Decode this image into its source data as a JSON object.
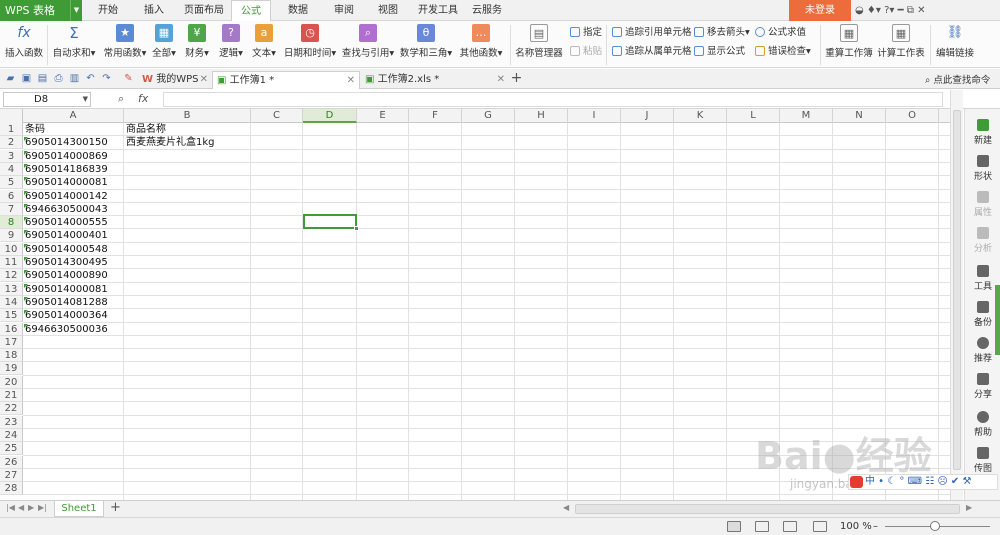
{
  "app": {
    "logo": "WPS 表格",
    "login": "未登录",
    "top_icons": "◒ ♦▾ ?▾  ━ ⧉ ✕"
  },
  "menu": [
    "开始",
    "插入",
    "页面布局",
    "公式",
    "数据",
    "审阅",
    "视图",
    "开发工具",
    "云服务"
  ],
  "menu_active": "公式",
  "ribbon": {
    "insert_function": "插入函数",
    "autosum": "自动求和",
    "common": "常用函数",
    "all": "全部",
    "finance": "财务",
    "logic": "逻辑",
    "text": "文本",
    "datetime": "日期和时间",
    "lookup": "查找与引用",
    "math": "数学和三角",
    "other": "其他函数",
    "name_manager": "名称管理器",
    "specify": "指定",
    "paste": "粘贴",
    "trace_precedents": "追踪引用单元格",
    "trace_dependents": "追踪从属单元格",
    "remove_arrows": "移去箭头",
    "show_formulas": "显示公式",
    "evaluate": "公式求值",
    "error_check": "错误检查",
    "recalc_workbook": "重算工作簿",
    "calc_sheet": "计算工作表",
    "edit_links": "编辑链接"
  },
  "tabs": {
    "my_wps": "我的WPS",
    "doc1": "工作簿1 *",
    "doc2": "工作簿2.xls *",
    "search_cmd": "点此查找命令"
  },
  "formula": {
    "namebox": "D8",
    "fx": "fx",
    "value": ""
  },
  "columns": [
    "A",
    "B",
    "C",
    "D",
    "E",
    "F",
    "G",
    "H",
    "I",
    "J",
    "K",
    "L",
    "M",
    "N",
    "O"
  ],
  "rows": [
    "1",
    "2",
    "3",
    "4",
    "5",
    "6",
    "7",
    "8",
    "9",
    "10",
    "11",
    "12",
    "13",
    "14",
    "15",
    "16",
    "17",
    "18",
    "19",
    "20",
    "21",
    "22",
    "23",
    "24",
    "25",
    "26",
    "27",
    "28"
  ],
  "selected": {
    "col": "D",
    "row": "8"
  },
  "cells": {
    "A": [
      "条码",
      "6905014300150",
      "6905014000869",
      "6905014186839",
      "6905014000081",
      "6905014000142",
      "6946630500043",
      "6905014000555",
      "6905014000401",
      "6905014000548",
      "6905014300495",
      "6905014000890",
      "6905014000081",
      "6905014081288",
      "6905014000364",
      "6946630500036"
    ],
    "B": [
      "商品名称",
      "西麦燕麦片礼盒1kg"
    ]
  },
  "sidebar": [
    "新建",
    "形状",
    "属性",
    "分析",
    "工具",
    "备份",
    "推荐",
    "分享",
    "帮助",
    "传图"
  ],
  "sheet_tab": "Sheet1",
  "add_sheet": "+",
  "status": {
    "zoom": "100 %",
    "minus": "–"
  },
  "watermark": {
    "main": "Bai●经验",
    "sub": "jingyan.baidu.com"
  },
  "ime": "中 • ☾ ° ⌨ ☷ ☹ ✔ ⚒"
}
